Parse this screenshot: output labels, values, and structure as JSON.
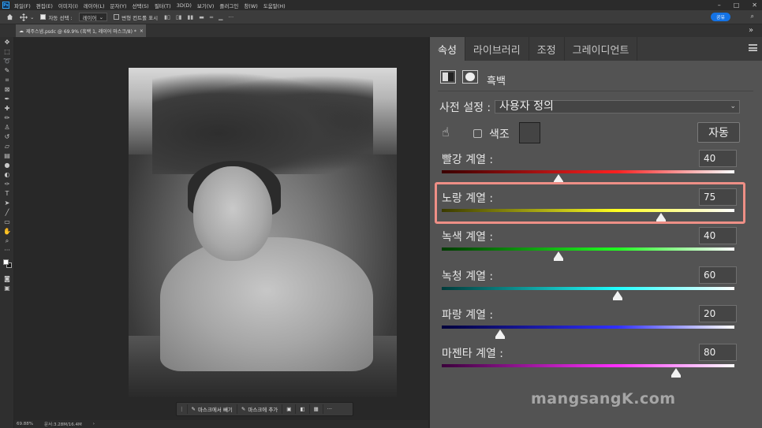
{
  "menubar": {
    "app_icon": "Ps",
    "items": [
      "파일(F)",
      "편집(E)",
      "이미지(I)",
      "레이어(L)",
      "문자(Y)",
      "선택(S)",
      "필터(T)",
      "3D(D)",
      "보기(V)",
      "플러그인",
      "창(W)",
      "도움말(H)"
    ],
    "window_controls": [
      "–",
      "□",
      "✕"
    ]
  },
  "options": {
    "auto_select_label": "자동 선택 :",
    "auto_select_value": "레이어",
    "transform_controls_label": "변형 컨트롤 표시",
    "share_label": "공유"
  },
  "document": {
    "tab_title": "제주스냅.psdc @ 69.9% (흑백 1, 레이어 마스크/8) *",
    "close_label": "×"
  },
  "statusbar": {
    "zoom": "69.88%",
    "doc_info": "문서:3.28M/16.4M"
  },
  "maskbar": {
    "subtract_label": "마스크에서 빼기",
    "add_label": "마스크에 추가",
    "more_label": "···"
  },
  "panel": {
    "tabs": [
      "속성",
      "라이브러리",
      "조정",
      "그레이디언트"
    ],
    "active_tab": "속성",
    "collapse_label": "»",
    "adjustment_name": "흑백",
    "preset_label": "사전 설정 :",
    "preset_value": "사용자 정의",
    "tint_label": "색조",
    "auto_label": "자동",
    "sliders": [
      {
        "label": "빨강 계열 :",
        "value": "40",
        "percent": 40,
        "gradient": [
          "#3a0000",
          "#ff2020",
          "#ffffff"
        ]
      },
      {
        "label": "노랑 계열 :",
        "value": "75",
        "percent": 75,
        "gradient": [
          "#3a3a00",
          "#ffff20",
          "#ffffff"
        ]
      },
      {
        "label": "녹색 계열 :",
        "value": "40",
        "percent": 40,
        "gradient": [
          "#003a00",
          "#20ff20",
          "#ffffff"
        ]
      },
      {
        "label": "녹청 계열 :",
        "value": "60",
        "percent": 60,
        "gradient": [
          "#003a3a",
          "#20ffff",
          "#ffffff"
        ]
      },
      {
        "label": "파랑 계열 :",
        "value": "20",
        "percent": 20,
        "gradient": [
          "#00003a",
          "#3030ff",
          "#ffffff"
        ]
      },
      {
        "label": "마젠타 계열 :",
        "value": "80",
        "percent": 80,
        "gradient": [
          "#3a003a",
          "#ff30ff",
          "#ffffff"
        ]
      }
    ],
    "highlight_color": "#ee8f86"
  },
  "watermark": "mangsangK.com"
}
